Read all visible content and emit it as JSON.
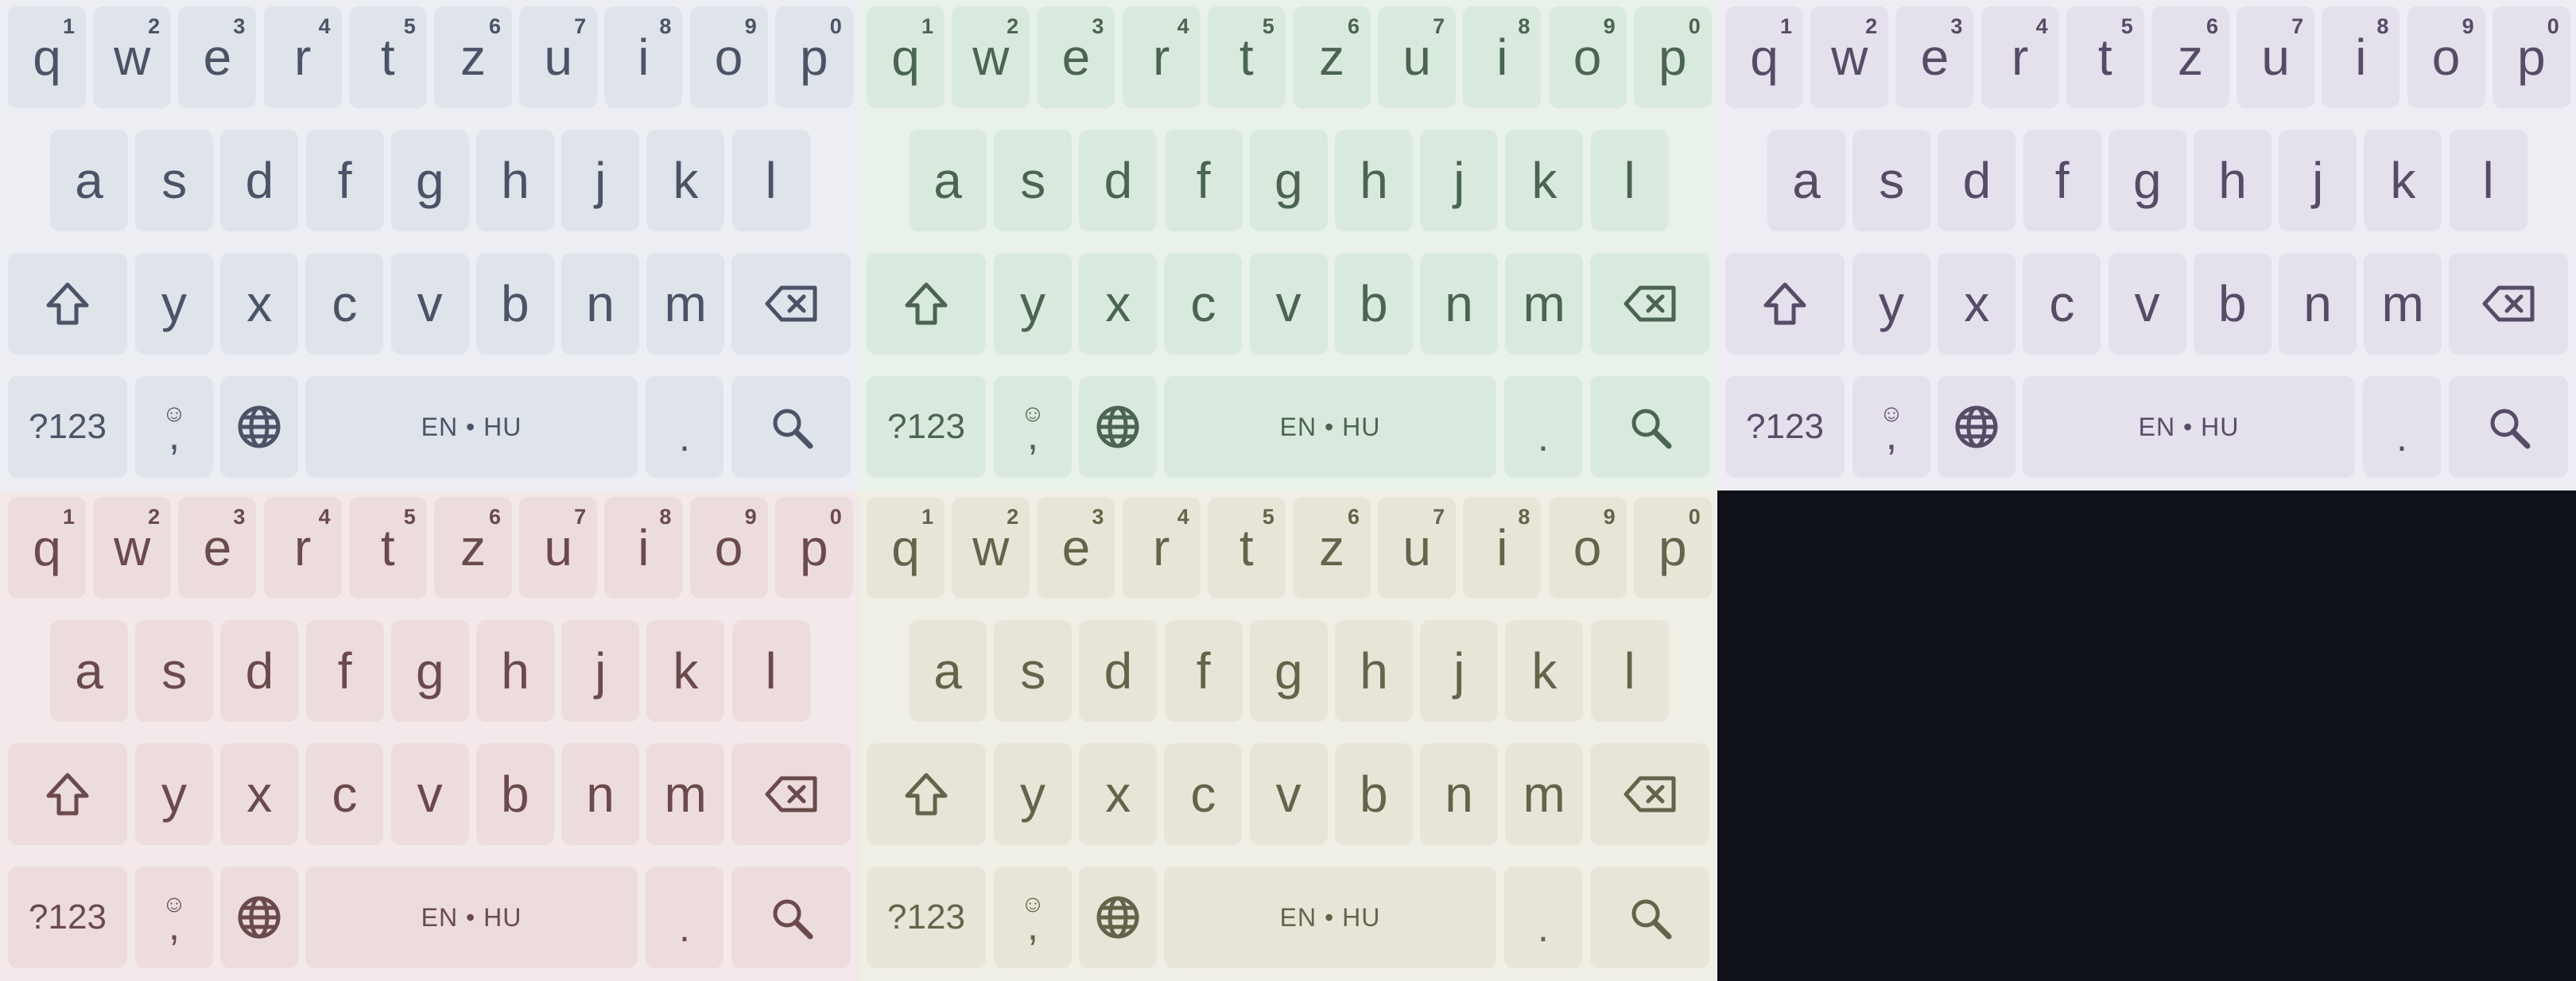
{
  "layout_name": "qwertz",
  "rows": {
    "row1": [
      {
        "label": "q",
        "hint": "1"
      },
      {
        "label": "w",
        "hint": "2"
      },
      {
        "label": "e",
        "hint": "3"
      },
      {
        "label": "r",
        "hint": "4"
      },
      {
        "label": "t",
        "hint": "5"
      },
      {
        "label": "z",
        "hint": "6"
      },
      {
        "label": "u",
        "hint": "7"
      },
      {
        "label": "i",
        "hint": "8"
      },
      {
        "label": "o",
        "hint": "9"
      },
      {
        "label": "p",
        "hint": "0"
      }
    ],
    "row2": [
      "a",
      "s",
      "d",
      "f",
      "g",
      "h",
      "j",
      "k",
      "l"
    ],
    "row3": [
      "y",
      "x",
      "c",
      "v",
      "b",
      "n",
      "m"
    ]
  },
  "bottom_row": {
    "symbols_label": "?123",
    "emoji_glyph": "☺",
    "comma_label": ",",
    "language_label": "EN • HU",
    "period_label": "."
  },
  "icons": {
    "shift": "shift-arrow-icon",
    "backspace": "backspace-icon",
    "globe": "globe-icon",
    "search": "search-icon"
  },
  "themes": [
    {
      "name": "blue-gray",
      "bg": "#eceef3",
      "key": "#dfe3ea",
      "text": "#4a5466"
    },
    {
      "name": "green",
      "bg": "#e8f1ea",
      "key": "#dae9dd",
      "text": "#4c6452"
    },
    {
      "name": "lavender",
      "bg": "#efedf3",
      "key": "#e4e0ec",
      "text": "#554c66"
    },
    {
      "name": "rose",
      "bg": "#f3e9ea",
      "key": "#eddcdd",
      "text": "#6b4a4c"
    },
    {
      "name": "olive",
      "bg": "#f0efe6",
      "key": "#e7e5d8",
      "text": "#66634a"
    }
  ],
  "empty_panel_color": "#0e1118"
}
